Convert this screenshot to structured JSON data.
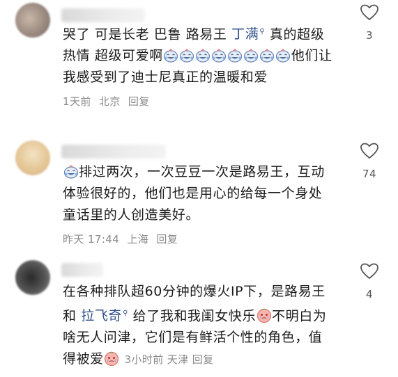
{
  "comments": [
    {
      "text_a": "哭了 可是长老 巴鲁 路易王 ",
      "mention": "丁满",
      "text_b": " 真的超级热情 超级可爱啊",
      "emoji_count": 8,
      "text_c": "他们让我感受到了迪士尼真正的温暖和爱",
      "time": "1天前",
      "location": "北京",
      "reply": "回复",
      "likes": "3"
    },
    {
      "emoji_count": 1,
      "text_a": "排过两次，一次豆豆一次是路易王，互动体验很好的，他们也是用心的给每一个身处童话里的人创造美好。",
      "time": "昨天 17:44",
      "location": "上海",
      "reply": "回复",
      "likes": "74"
    },
    {
      "text_a": "在各种排队超60分钟的爆火IP下，是路易王和 ",
      "mention": "拉飞奇",
      "text_b": " 给了我和我闺女快乐",
      "text_c": "不明白为啥无人问津，它们是有鲜活个性的角色，值得被爱",
      "time": "3小时前",
      "location": "天津",
      "reply": "回复",
      "likes": "4"
    }
  ]
}
